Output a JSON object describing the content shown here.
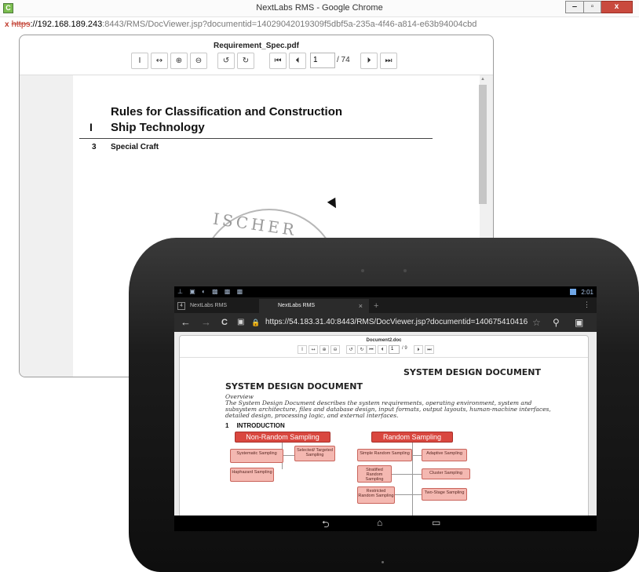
{
  "window": {
    "title": "NextLabs RMS - Google Chrome",
    "app_icon": "C",
    "controls": {
      "minimize": "‒",
      "maximize": "▫",
      "close": "x"
    }
  },
  "url": {
    "warn_icon": "x",
    "protocol": "https",
    "host": "://192.168.189.243",
    "path": ":8443/RMS/DocViewer.jsp?documentid=14029042019309f5dbf5a-235a-4f46-a814-e63b94004cbd"
  },
  "desktop_viewer": {
    "doc_title": "Requirement_Spec.pdf",
    "toolbar": {
      "fit_height": "I",
      "fit_width": "↔",
      "zoom_in": "⊕",
      "zoom_out": "⊖",
      "rotate_left": "↺",
      "rotate_right": "↻",
      "first_page": "⏮",
      "prev_page": "⏴",
      "next_page": "⏵",
      "last_page": "⏭"
    },
    "page_current": "1",
    "page_total": "/ 74",
    "document": {
      "heading": "Rules for Classification and Construction",
      "roman": "I",
      "subheading": "Ship Technology",
      "section_number": "3",
      "section_title": "Special Craft",
      "seal_text": "ISCHER"
    }
  },
  "tablet": {
    "status": {
      "notifications": "⊥ ▣ ◐ ▩ ▩ ▩",
      "time": "2:01"
    },
    "tabs": [
      {
        "number": "4",
        "label": "NextLabs RMS"
      },
      {
        "label": "NextLabs RMS",
        "close": "×"
      }
    ],
    "new_tab": "+",
    "menu": "⋮",
    "omnibox": {
      "back": "←",
      "forward": "→",
      "reload": "C",
      "reader": "▣",
      "lock": "🔒",
      "url": "https://54.183.31.40:8443/RMS/DocViewer.jsp?documentid=140675410416",
      "star": "☆",
      "search": "⚲",
      "bookmark": "▣"
    },
    "viewer": {
      "doc_title": "Document2.doc",
      "toolbar": {
        "fit_height": "I",
        "fit_width": "↔",
        "zoom_in": "⊕",
        "zoom_out": "⊖",
        "rotate_left": "↺",
        "rotate_right": "↻",
        "first_page": "⏮",
        "prev_page": "⏴",
        "next_page": "⏵",
        "last_page": "⏭"
      },
      "page_current": "1",
      "page_total": "/ 9",
      "document": {
        "header_right": "SYSTEM DESIGN DOCUMENT",
        "title": "SYSTEM DESIGN DOCUMENT",
        "overview_label": "Overview",
        "overview_text": "The System Design Document describes the system requirements, operating environment, system and subsystem architecture, files and database design, input formats, output layouts, human-machine interfaces, detailed design, processing logic, and external interfaces.",
        "intro_number": "1",
        "intro_title": "INTRODUCTION",
        "diagram": {
          "left_head": "Non-Random Sampling",
          "left_items": [
            "Systematic Sampling",
            "Selected/ Targeted Sampling",
            "Haphazard Sampling"
          ],
          "right_head": "Random Sampling",
          "right_items": [
            "Simple Random Sampling",
            "Adaptive Sampling",
            "Stratified Random Sampling",
            "Cluster Sampling",
            "Restricted Random Sampling",
            "Two-Stage Sampling"
          ]
        }
      }
    },
    "navbar": {
      "back": "⮌",
      "home": "⌂",
      "recent": "▭"
    }
  },
  "colors": {
    "diagram_head": "#d9473f",
    "diagram_box": "#f4b8b1",
    "url_warn": "#c0392b",
    "close_button": "#c94a3e"
  }
}
